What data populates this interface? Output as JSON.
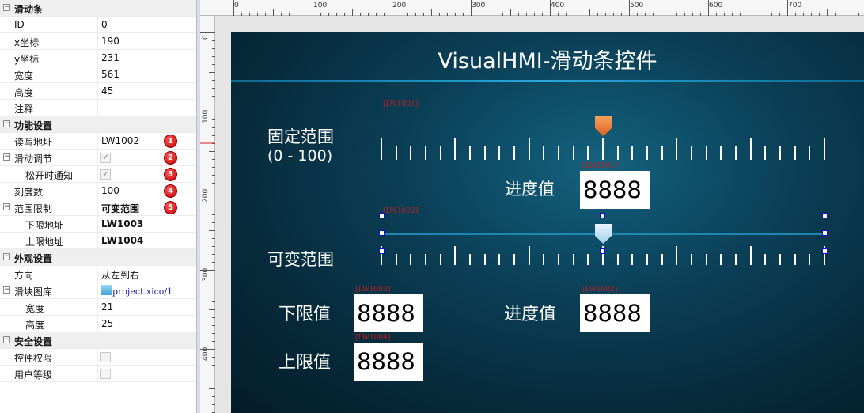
{
  "properties": {
    "sections": [
      {
        "label": "滑动条",
        "rows": [
          {
            "label": "ID",
            "value": "0"
          },
          {
            "label": "x坐标",
            "value": "190"
          },
          {
            "label": "y坐标",
            "value": "231"
          },
          {
            "label": "宽度",
            "value": "561"
          },
          {
            "label": "高度",
            "value": "45"
          },
          {
            "label": "注释",
            "value": ""
          }
        ]
      },
      {
        "label": "功能设置",
        "rows": [
          {
            "label": "读写地址",
            "value": "LW1002",
            "badge": "1"
          },
          {
            "label": "滑动调节",
            "checked": true,
            "badge": "2"
          },
          {
            "label": "松开时通知",
            "checked": true,
            "badge": "3"
          },
          {
            "label": "刻度数",
            "value": "100",
            "badge": "4"
          },
          {
            "label": "范围限制",
            "value": "可变范围",
            "badge": "5"
          },
          {
            "label": "下限地址",
            "value": "LW1003"
          },
          {
            "label": "上限地址",
            "value": "LW1004"
          }
        ]
      },
      {
        "label": "外观设置",
        "rows": [
          {
            "label": "方向",
            "value": "从左到右"
          },
          {
            "label": "滑块图库",
            "value": "project.xico/1"
          },
          {
            "label": "宽度",
            "value": "21"
          },
          {
            "label": "高度",
            "value": "25"
          }
        ]
      },
      {
        "label": "安全设置",
        "rows": [
          {
            "label": "控件权限",
            "checked": false
          },
          {
            "label": "用户等级",
            "checked": false
          }
        ]
      }
    ],
    "toggle_symbol": "−",
    "check_symbol": "✓"
  },
  "rulers": {
    "top": [
      "0",
      "100",
      "200",
      "300",
      "400",
      "500",
      "600",
      "700"
    ],
    "left": [
      "0",
      "100",
      "200",
      "300",
      "400"
    ]
  },
  "hmi": {
    "title": "VisualHMI-滑动条控件",
    "fixed": {
      "label_line1": "固定范围",
      "label_line2": "(0 - 100)",
      "address_tag": "[LW1001]",
      "progress_label": "进度值",
      "progress_tag": "[LW1001]",
      "progress_value": "8888"
    },
    "variable": {
      "label": "可变范围",
      "address_tag": "[LW1002]",
      "lower_label": "下限值",
      "lower_tag": "[LW1003]",
      "lower_value": "8888",
      "progress_label": "进度值",
      "progress_tag": "[LW1002]",
      "progress_value": "8888",
      "upper_label": "上限值",
      "upper_tag": "[LW1004]",
      "upper_value": "8888"
    },
    "colors": {
      "thumb_orange": "#e8702a",
      "thumb_blue": "#cfe8f8",
      "track": "#1e86b3"
    }
  }
}
